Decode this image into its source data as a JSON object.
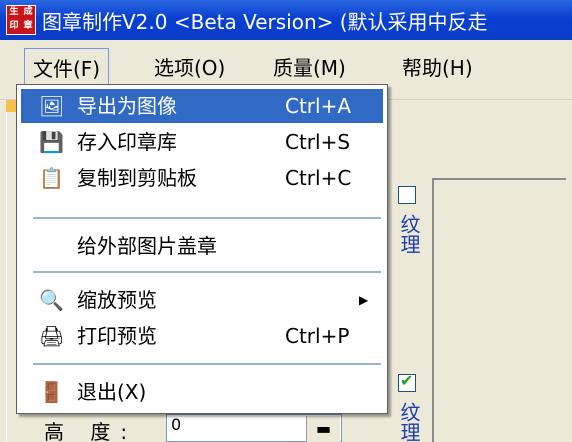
{
  "window": {
    "title": "图章制作V2.0 <Beta Version> (默认采用中反走",
    "icon_chars": [
      "生",
      "成",
      "印",
      "章"
    ]
  },
  "menubar": {
    "items": [
      {
        "label": "文件(F)"
      },
      {
        "label": "选项(O)"
      },
      {
        "label": "质量(M)"
      },
      {
        "label": "帮助(H)"
      }
    ]
  },
  "file_menu": {
    "items": [
      {
        "label": "导出为图像",
        "shortcut": "Ctrl+A",
        "icon": "export-image-icon"
      },
      {
        "label": "存入印章库",
        "shortcut": "Ctrl+S",
        "icon": "save-library-icon"
      },
      {
        "label": "复制到剪贴板",
        "shortcut": "Ctrl+C",
        "icon": "copy-icon"
      },
      {
        "label": "给外部图片盖章",
        "shortcut": "",
        "icon": ""
      },
      {
        "label": "缩放预览",
        "shortcut": "",
        "icon": "magnifier-icon",
        "submenu": true
      },
      {
        "label": "打印预览",
        "shortcut": "Ctrl+P",
        "icon": "printer-icon"
      },
      {
        "label": "退出(X)",
        "shortcut": "",
        "icon": "exit-icon"
      }
    ]
  },
  "background": {
    "texture_label_1": "纹理",
    "texture_label_2": "纹理",
    "texture_checkbox_1_checked": false,
    "texture_checkbox_2_checked": true,
    "height_label": "高 度:",
    "height_value": "0",
    "spin_glyph": "▬"
  },
  "colors": {
    "titlebar": "#0a3fd0",
    "menu_highlight": "#316ac5",
    "vertical_text": "#1b3fb0"
  }
}
